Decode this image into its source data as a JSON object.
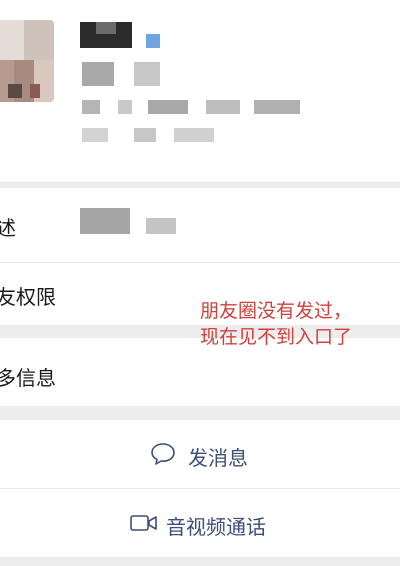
{
  "rows": {
    "description_label": "述",
    "moments_permission_label": "友权限",
    "more_info_label": "多信息"
  },
  "actions": {
    "send_message": "发消息",
    "av_call": "音视频通话"
  },
  "annotation": {
    "line1": "朋友圈没有发过，",
    "line2": "现在见不到入口了"
  },
  "icons": {
    "message": "chat-bubble-icon",
    "video": "video-camera-icon"
  },
  "colors": {
    "action_text": "#3d4e78",
    "annotation": "#d0413d",
    "background": "#ededed"
  }
}
